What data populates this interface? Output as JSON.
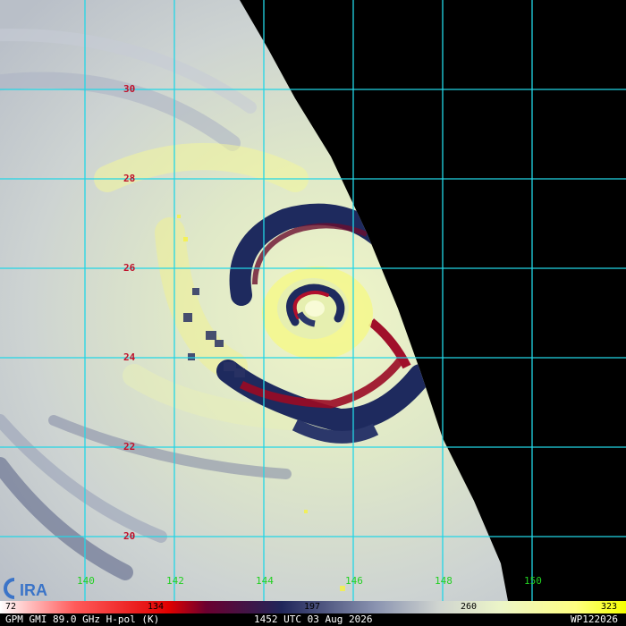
{
  "image": {
    "lat_labels": [
      "30",
      "28",
      "26",
      "24",
      "22",
      "20"
    ],
    "lon_labels": [
      "140",
      "142",
      "144",
      "146",
      "148",
      "150"
    ],
    "colorbar_ticks": [
      "72",
      "134",
      "197",
      "260",
      "323"
    ],
    "logo_text": "CIRA",
    "footer": {
      "sensor": "GPM GMI 89.0 GHz H-pol (K)",
      "time": "1452 UTC 03 Aug 2026",
      "storm": "WP122026"
    },
    "colors": {
      "grid": "#22d6e6",
      "lat_label": "#c0102a",
      "lon_label": "#22d022",
      "no_data": "#000000"
    }
  }
}
